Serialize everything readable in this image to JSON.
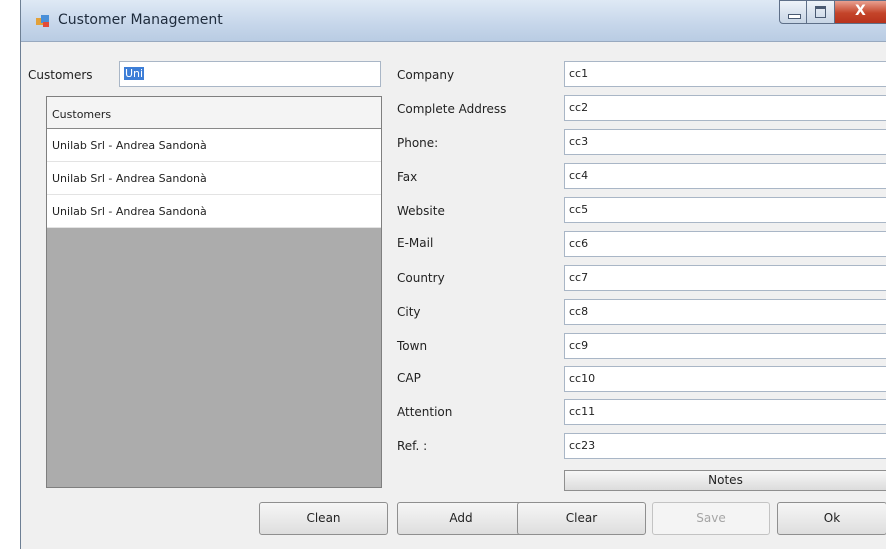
{
  "window": {
    "title": "Customer Management",
    "close_glyph": "X"
  },
  "search": {
    "label": "Customers",
    "value": "Uni"
  },
  "customers_list": {
    "header": "Customers",
    "rows": [
      "Unilab Srl - Andrea Sandonà",
      "Unilab Srl - Andrea Sandonà",
      "Unilab Srl - Andrea Sandonà"
    ]
  },
  "fields": [
    {
      "label": "Company",
      "value": "cc1"
    },
    {
      "label": "Complete Address",
      "value": "cc2"
    },
    {
      "label": "Phone:",
      "value": "cc3"
    },
    {
      "label": "Fax",
      "value": "cc4"
    },
    {
      "label": "Website",
      "value": "cc5"
    },
    {
      "label": "E-Mail",
      "value": "cc6"
    },
    {
      "label": "Country",
      "value": "cc7"
    },
    {
      "label": "City",
      "value": "cc8"
    },
    {
      "label": "Town",
      "value": "cc9"
    },
    {
      "label": "CAP",
      "value": "cc10"
    },
    {
      "label": "Attention",
      "value": "cc11"
    },
    {
      "label": "Ref. :",
      "value": "cc23"
    }
  ],
  "buttons": {
    "notes": "Notes",
    "clean": "Clean",
    "add": "Add",
    "clear": "Clear",
    "save": "Save",
    "ok": "Ok"
  },
  "icons": {
    "app": "app-window-icon",
    "minimize": "minimize-icon",
    "maximize": "maximize-icon",
    "close": "close-icon"
  }
}
